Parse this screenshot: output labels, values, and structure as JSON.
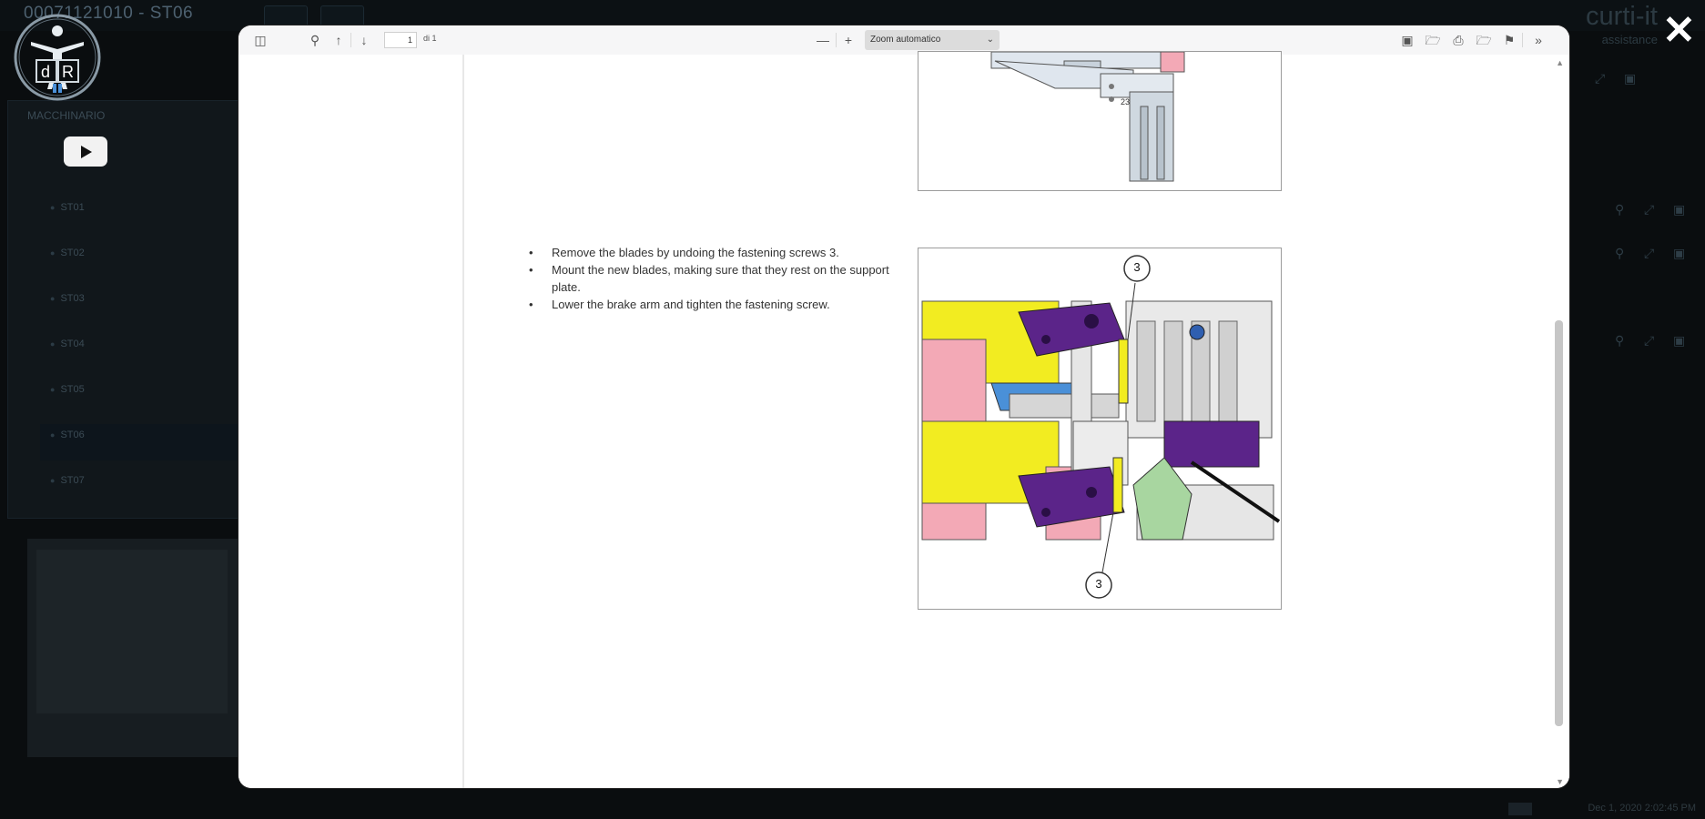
{
  "background_app": {
    "title": "00071121010 - ST06",
    "brand": "curti-it",
    "brand_sub": "assistance",
    "panel_header": "MACCHINARIO",
    "nav_items": [
      "ST01",
      "ST02",
      "ST03",
      "ST04",
      "ST05",
      "ST06",
      "ST07"
    ],
    "active_item": "ST06",
    "status_time": "Dec 1, 2020 2:02:45 PM"
  },
  "logo": {
    "name": "dr-logo"
  },
  "close": {
    "label": "✕"
  },
  "pdf_toolbar": {
    "page_number": "1",
    "page_count": "di 1",
    "zoom": "Zoom automatico",
    "zoom_out_label": "—",
    "zoom_in_label": "+"
  },
  "document": {
    "bullets": [
      "Remove the blades by undoing the fastening screws 3.",
      "Mount the new blades, making sure that they rest on the support plate.",
      "Lower the brake arm and tighten the fastening screw."
    ],
    "callout_top": "3",
    "callout_bottom": "3"
  },
  "colors": {
    "yellow": "#f2ec21",
    "purple": "#5b2489",
    "pink": "#f3a9b6",
    "blue": "#4a90d8",
    "green": "#a8d6a0",
    "grey": "#d6d6d6"
  }
}
